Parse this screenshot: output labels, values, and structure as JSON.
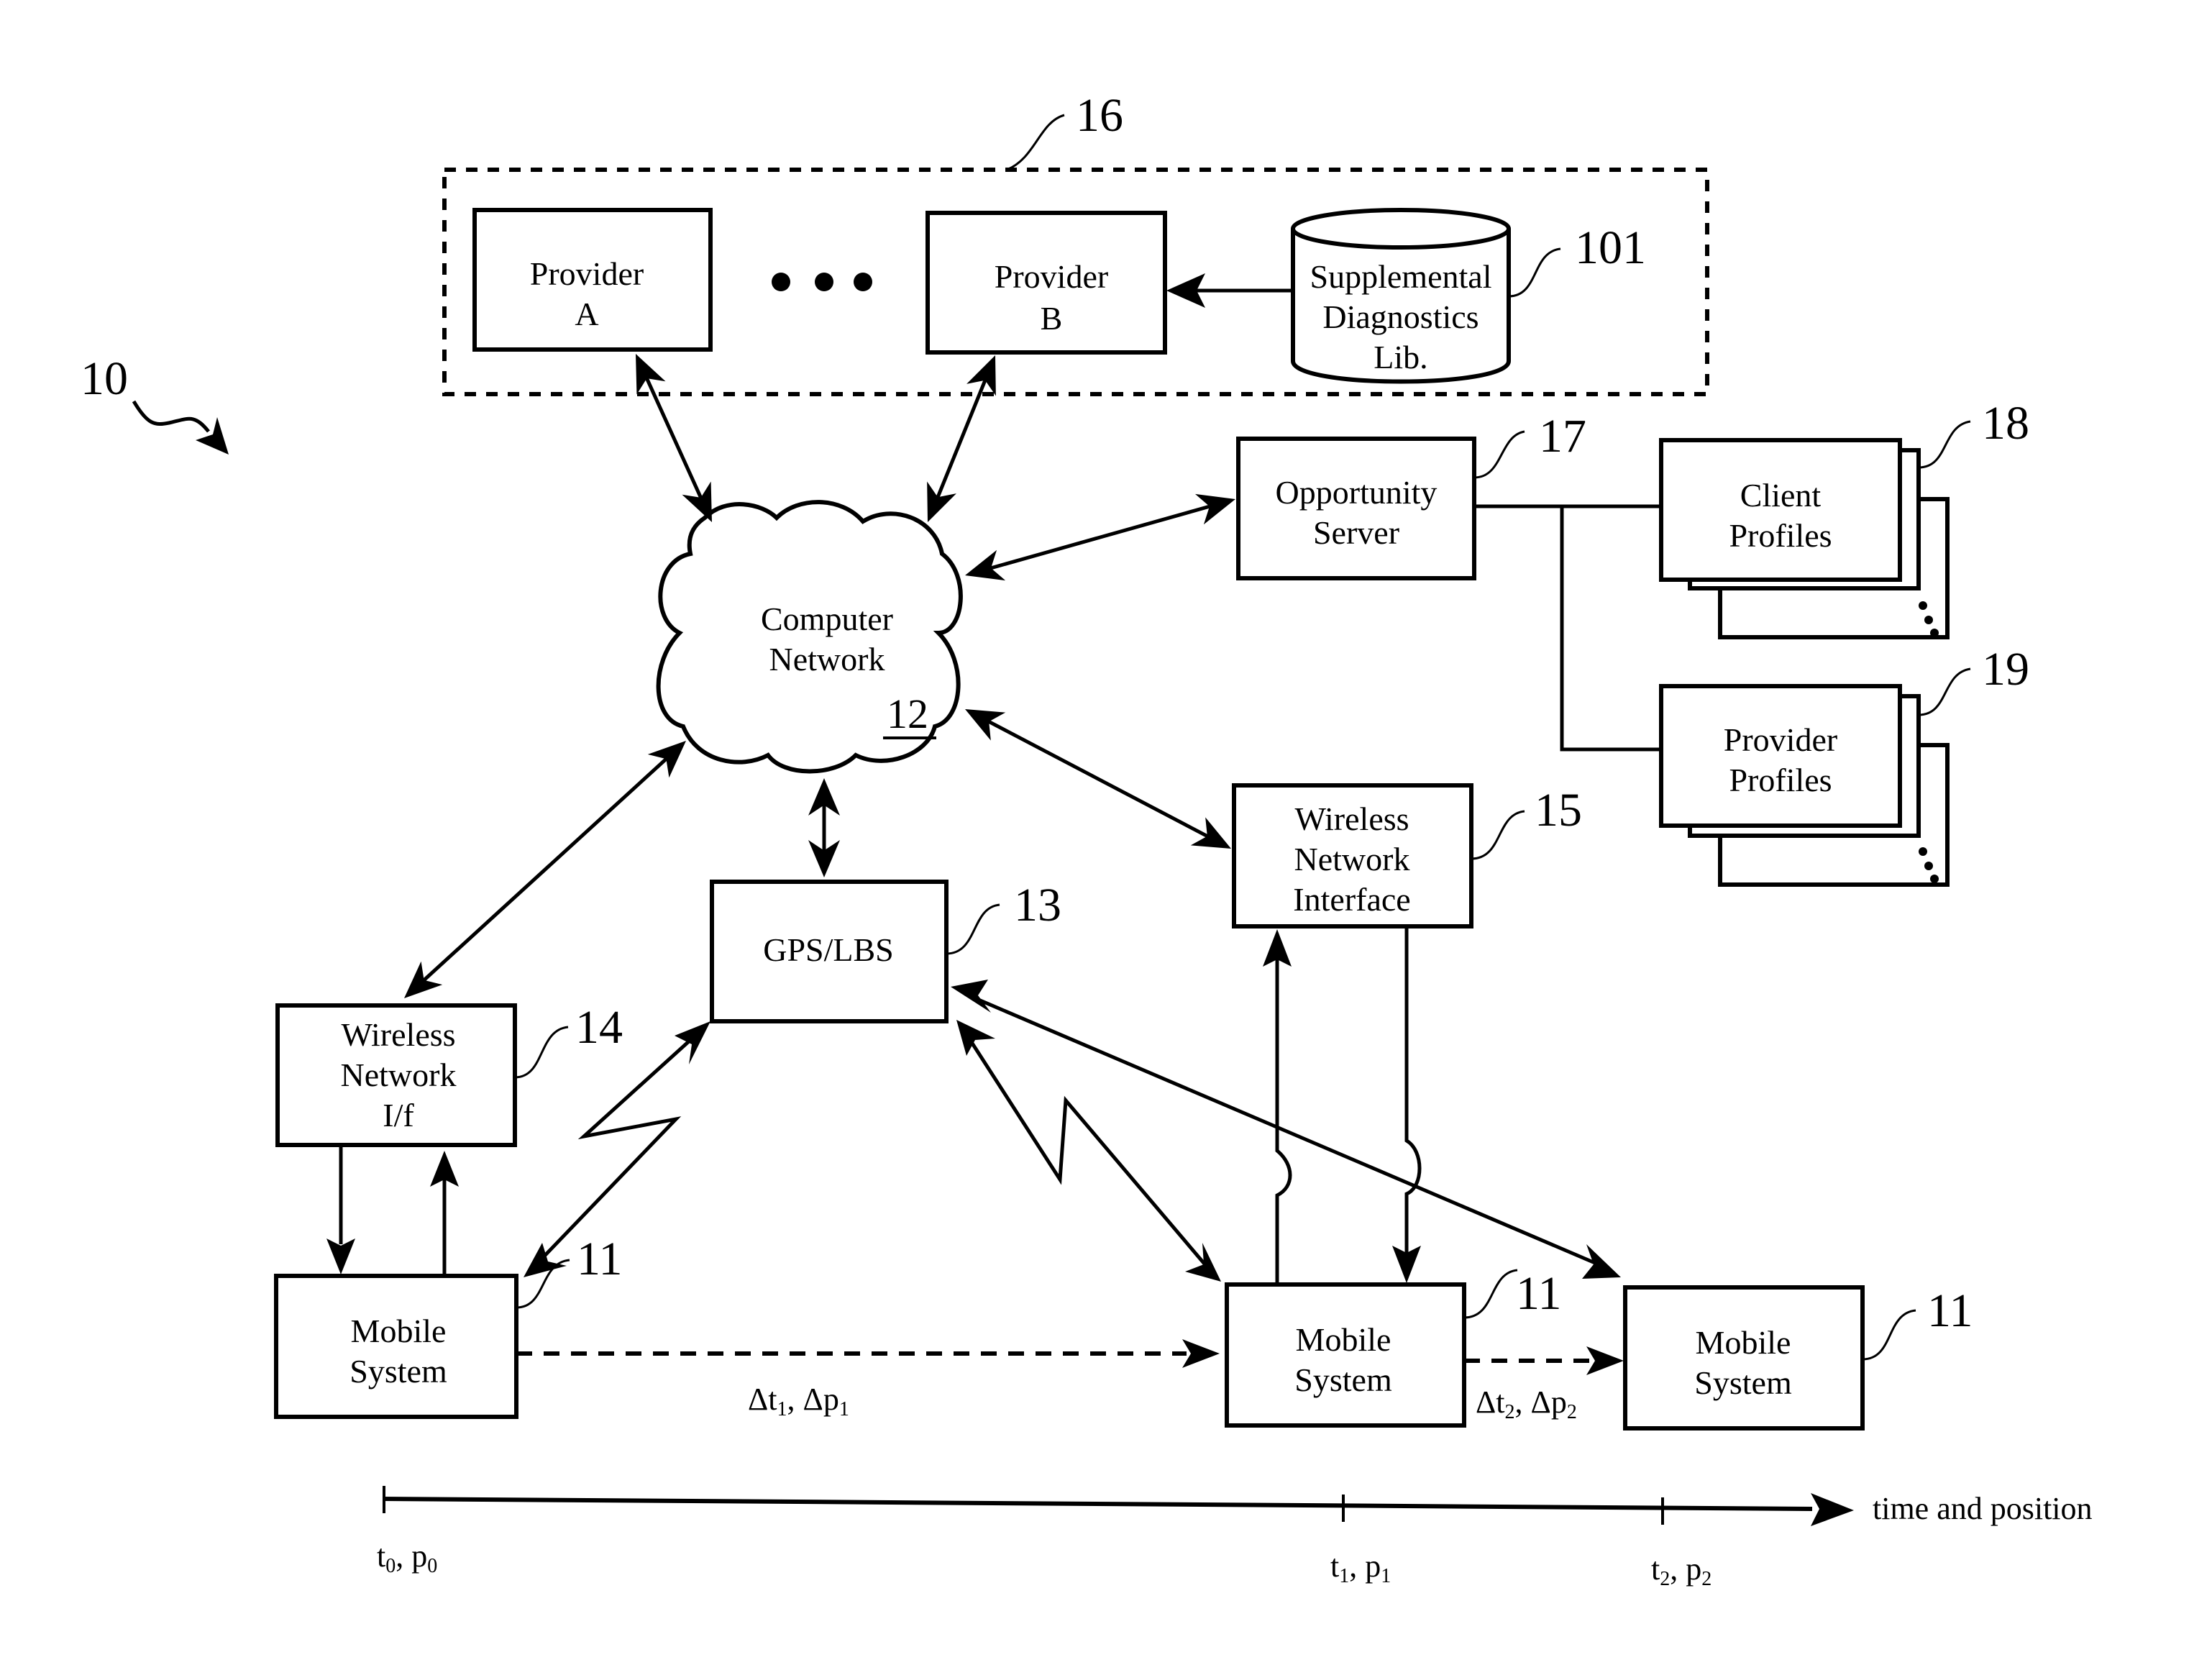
{
  "figure": {
    "system_ref": "10",
    "provider_group_ref": "16",
    "nodes": {
      "provider_a": {
        "line1": "Provider",
        "line2": "A"
      },
      "provider_b": {
        "line1": "Provider",
        "line2": "B"
      },
      "ellipsis": "•••",
      "supplemental_lib": {
        "line1": "Supplemental",
        "line2": "Diagnostics",
        "line3": "Lib.",
        "ref": "101"
      },
      "computer_network": {
        "line1": "Computer",
        "line2": "Network",
        "ref": "12"
      },
      "opportunity_server": {
        "line1": "Opportunity",
        "line2": "Server",
        "ref": "17"
      },
      "client_profiles": {
        "line1": "Client",
        "line2": "Profiles",
        "ref": "18"
      },
      "provider_profiles": {
        "line1": "Provider",
        "line2": "Profiles",
        "ref": "19"
      },
      "gps_lbs": {
        "label": "GPS/LBS",
        "ref": "13"
      },
      "wireless_if_left": {
        "line1": "Wireless",
        "line2": "Network",
        "line3": "I/f",
        "ref": "14"
      },
      "wireless_if_right": {
        "line1": "Wireless",
        "line2": "Network",
        "line3": "Interface",
        "ref": "15"
      },
      "mobile_0": {
        "line1": "Mobile",
        "line2": "System",
        "ref": "11"
      },
      "mobile_1": {
        "line1": "Mobile",
        "line2": "System",
        "ref": "11"
      },
      "mobile_2": {
        "line1": "Mobile",
        "line2": "System",
        "ref": "11"
      }
    },
    "transitions": {
      "first": {
        "dt": "Δt",
        "dt_sub": "1",
        "dp": "Δp",
        "dp_sub": "1"
      },
      "second": {
        "dt": "Δt",
        "dt_sub": "2",
        "dp": "Δp",
        "dp_sub": "2"
      }
    },
    "timeline": {
      "label": "time and position",
      "ticks": [
        {
          "t": "t",
          "p": "p",
          "sub": "0"
        },
        {
          "t": "t",
          "p": "p",
          "sub": "1"
        },
        {
          "t": "t",
          "p": "p",
          "sub": "2"
        }
      ]
    }
  }
}
